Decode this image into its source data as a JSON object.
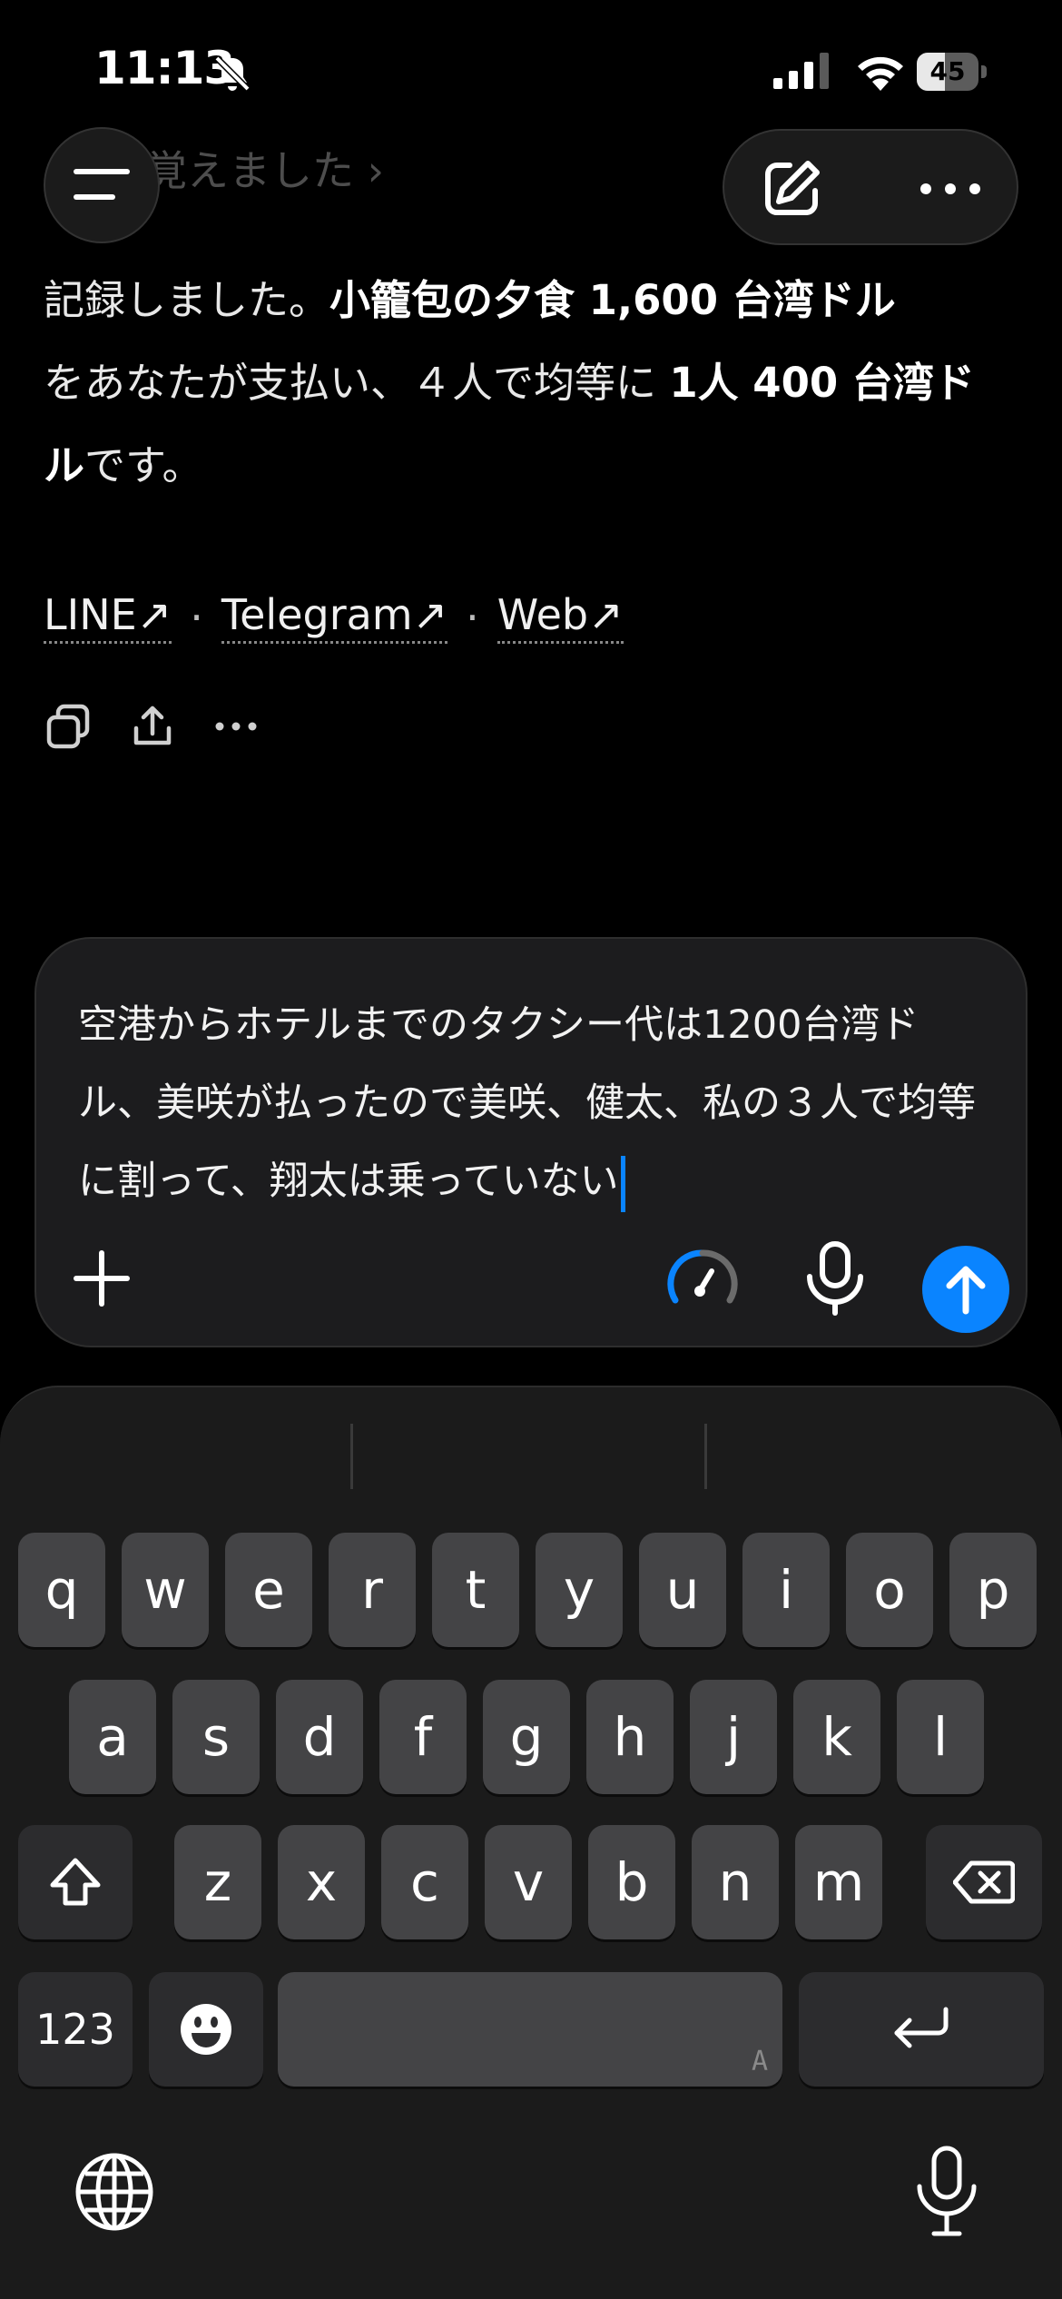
{
  "status_bar": {
    "time": "11:13",
    "battery": "45",
    "battery_level": 0.45
  },
  "header": {
    "faded_link_text": "覚えました ›"
  },
  "message": {
    "part1": "記録しました。",
    "bold1": "小籠包の夕食 1,600 台湾ドル",
    "part2": "をあなたが支払い、４人で均等に ",
    "bold2": "1人 400 台湾ドル",
    "part3": "です。"
  },
  "links": [
    {
      "label": "LINE↗"
    },
    {
      "label": "Telegram↗"
    },
    {
      "label": "Web↗"
    }
  ],
  "link_separator": "·",
  "actions": [
    "copy-icon",
    "share-icon",
    "more-icon"
  ],
  "composer": {
    "draft": "空港からホテルまでのタクシー代は1200台湾ドル、美咲が払ったので美咲、健太、私の３人で均等に割って、翔太は乗っていない"
  },
  "keyboard": {
    "row1": [
      "q",
      "w",
      "e",
      "r",
      "t",
      "y",
      "u",
      "i",
      "o",
      "p"
    ],
    "row2": [
      "a",
      "s",
      "d",
      "f",
      "g",
      "h",
      "j",
      "k",
      "l"
    ],
    "row3": [
      "z",
      "x",
      "c",
      "v",
      "b",
      "n",
      "m"
    ],
    "numbers_key": "123",
    "space_mark": "A"
  },
  "colors": {
    "accent": "#0a84ff",
    "background": "#000000",
    "composer": "#1c1c1e",
    "key": "#444446"
  }
}
